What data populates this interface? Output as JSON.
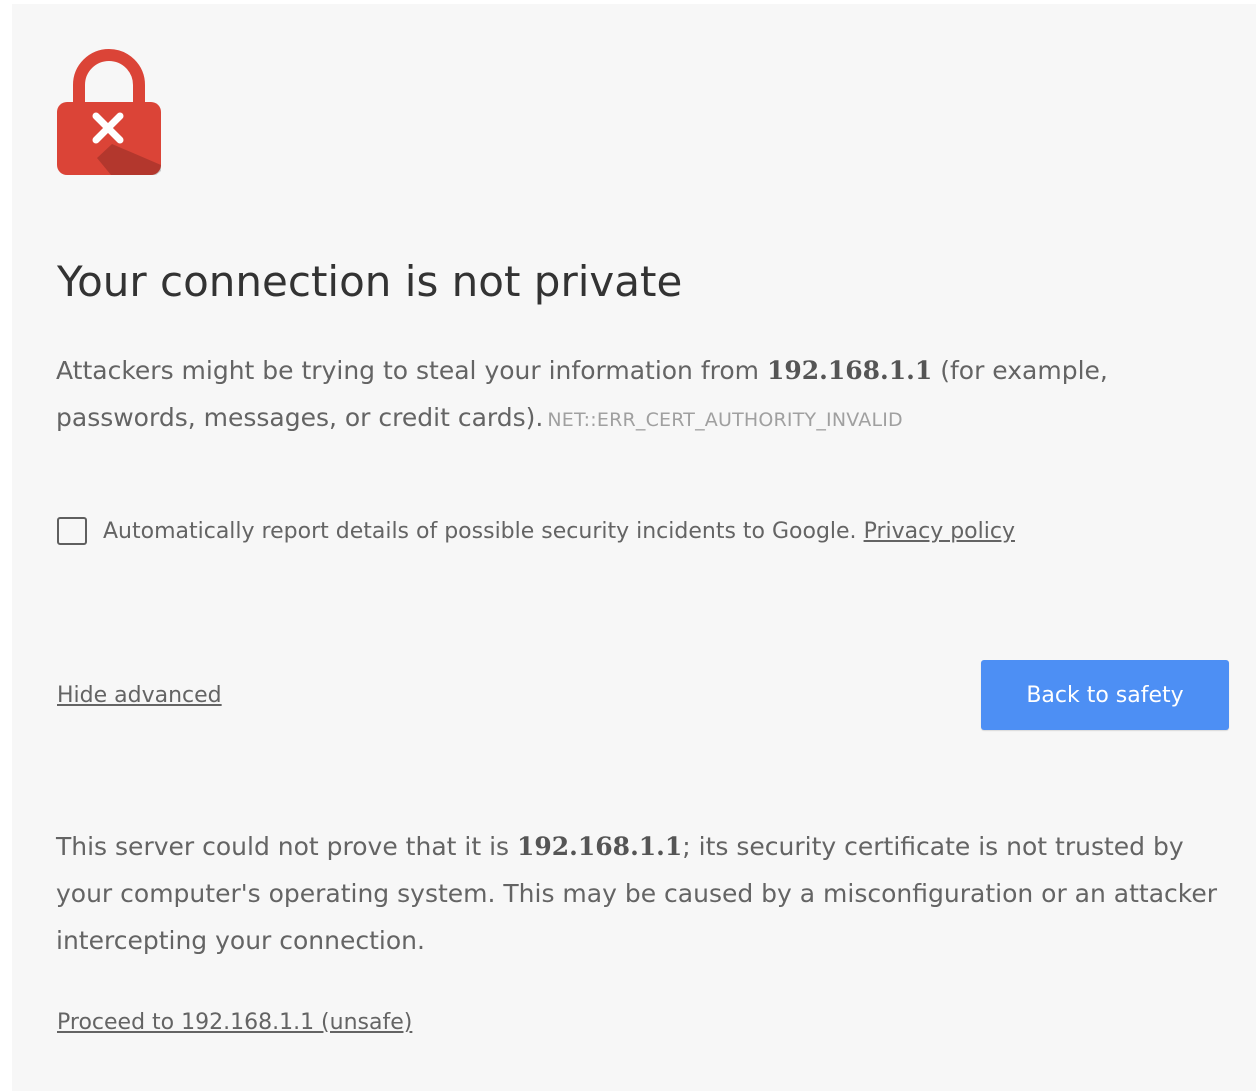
{
  "heading": "Your connection is not private",
  "main_message": {
    "before_host": "Attackers might be trying to steal your information from ",
    "host": "192.168.1.1",
    "after_host": " (for example, passwords, messages, or credit cards).",
    "error_code": "NET::ERR_CERT_AUTHORITY_INVALID"
  },
  "report": {
    "checked": false,
    "text": "Automatically report details of possible security incidents to Google.",
    "privacy_link": "Privacy policy"
  },
  "hide_advanced": "Hide advanced",
  "back_button": "Back to safety",
  "details": {
    "before_host": "This server could not prove that it is ",
    "host": "192.168.1.1",
    "after_host": "; its security certificate is not trusted by your computer's operating system. This may be caused by a misconfiguration or an attacker intercepting your connection."
  },
  "proceed_link": "Proceed to 192.168.1.1 (unsafe)",
  "colors": {
    "lock_red": "#db4437",
    "button_blue": "#4d8ff4",
    "background": "#f7f7f7"
  },
  "icons": {
    "lock": "lock-error-icon",
    "x_mark": "x-mark-icon"
  }
}
